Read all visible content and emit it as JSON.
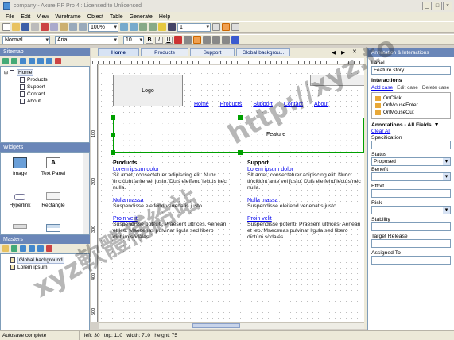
{
  "window": {
    "title": "company - Axure RP Pro 4 : Licensed to Unlicensed"
  },
  "menu": [
    "File",
    "Edit",
    "View",
    "Wireframe",
    "Object",
    "Table",
    "Generate",
    "Help"
  ],
  "toolbar1": {
    "zoom": "100%",
    "line_width": "1"
  },
  "toolbar2": {
    "style": "Normal",
    "font": "Arial",
    "size": "10",
    "bold": "B",
    "italic": "I",
    "underline": "U"
  },
  "sitemap": {
    "title": "Sitemap",
    "root": "Home",
    "pages": [
      "Products",
      "Support",
      "Contact",
      "About"
    ]
  },
  "widgets": {
    "title": "Widgets",
    "items": [
      "Image",
      "Text Panel",
      "Hyperlink",
      "Rectangle",
      "",
      ""
    ]
  },
  "masters": {
    "title": "Masters",
    "items": [
      "Global background",
      "Lorem ipsum"
    ]
  },
  "tabs": [
    "Home",
    "Products",
    "Support",
    "Global backgrou..."
  ],
  "tab_controls": [
    "◀",
    "▶",
    "✕"
  ],
  "design": {
    "logo": "Logo",
    "nav": [
      "Home",
      "Products",
      "Support",
      "Contact",
      "About"
    ],
    "feature": "Feature",
    "col1": {
      "heading": "Products",
      "items": [
        {
          "link": "Lorem ipsum dolor",
          "text": "Sit amet, consectetuer adipiscing elit. Nunc tincidunt ante vel justo. Duis eleifend lectus nec nulla."
        },
        {
          "link": "Nulla massa",
          "text": "Suspendisse eleifend venenatis justo."
        },
        {
          "link": "Proin velit",
          "text": "Suspendisse potenti. Praesent ultrices. Aenean et leo. Maecenas pulvinar ligula sed libero dictum sodales."
        }
      ]
    },
    "col2": {
      "heading": "Support",
      "items": [
        {
          "link": "Lorem ipsum dolor",
          "text": "Sit amet, consectetuer adipiscing elit. Nunc tincidunt ante vel justo. Duis eleifend lectus nec nulla."
        },
        {
          "link": "Nulla massa",
          "text": "Suspendisse eleifend venenatis justo."
        },
        {
          "link": "Proin velit",
          "text": "Suspendisse potenti. Praesent ultrices. Aenean et leo. Maecenas pulvinar ligula sed libero dictum sodales."
        }
      ]
    }
  },
  "ruler": {
    "h": [
      "100",
      "200",
      "300",
      "400",
      "500"
    ],
    "v": [
      "100",
      "200",
      "300",
      "400",
      "500"
    ]
  },
  "props": {
    "header": "Annotation & Interactions",
    "label_title": "Label",
    "label_value": "Feature story",
    "interactions_title": "Interactions",
    "case_actions": [
      "Add case",
      "Edit case",
      "Delete case"
    ],
    "events": [
      "OnClick",
      "OnMouseEnter",
      "OnMouseOut"
    ],
    "annotations_title": "Annotations - All Fields",
    "clear_all": "Clear All",
    "fields": [
      {
        "label": "Specification",
        "type": "input",
        "value": ""
      },
      {
        "label": "Status",
        "type": "select",
        "value": "Proposed"
      },
      {
        "label": "Benefit",
        "type": "select",
        "value": ""
      },
      {
        "label": "Effort",
        "type": "input",
        "value": ""
      },
      {
        "label": "Risk",
        "type": "select",
        "value": ""
      },
      {
        "label": "Stability",
        "type": "input",
        "value": ""
      },
      {
        "label": "Target Release",
        "type": "input",
        "value": ""
      },
      {
        "label": "Assigned To",
        "type": "input",
        "value": ""
      }
    ]
  },
  "status": {
    "left": "Autosave complete",
    "position": "left: 30   top: 110   width: 710   height: 75"
  },
  "watermarks": [
    "http://xyz.to",
    "xyz軟體補給站"
  ],
  "colors": {
    "panel_header": "#6a86b8",
    "link": "#0000ee",
    "selection_green": "#00a000"
  }
}
